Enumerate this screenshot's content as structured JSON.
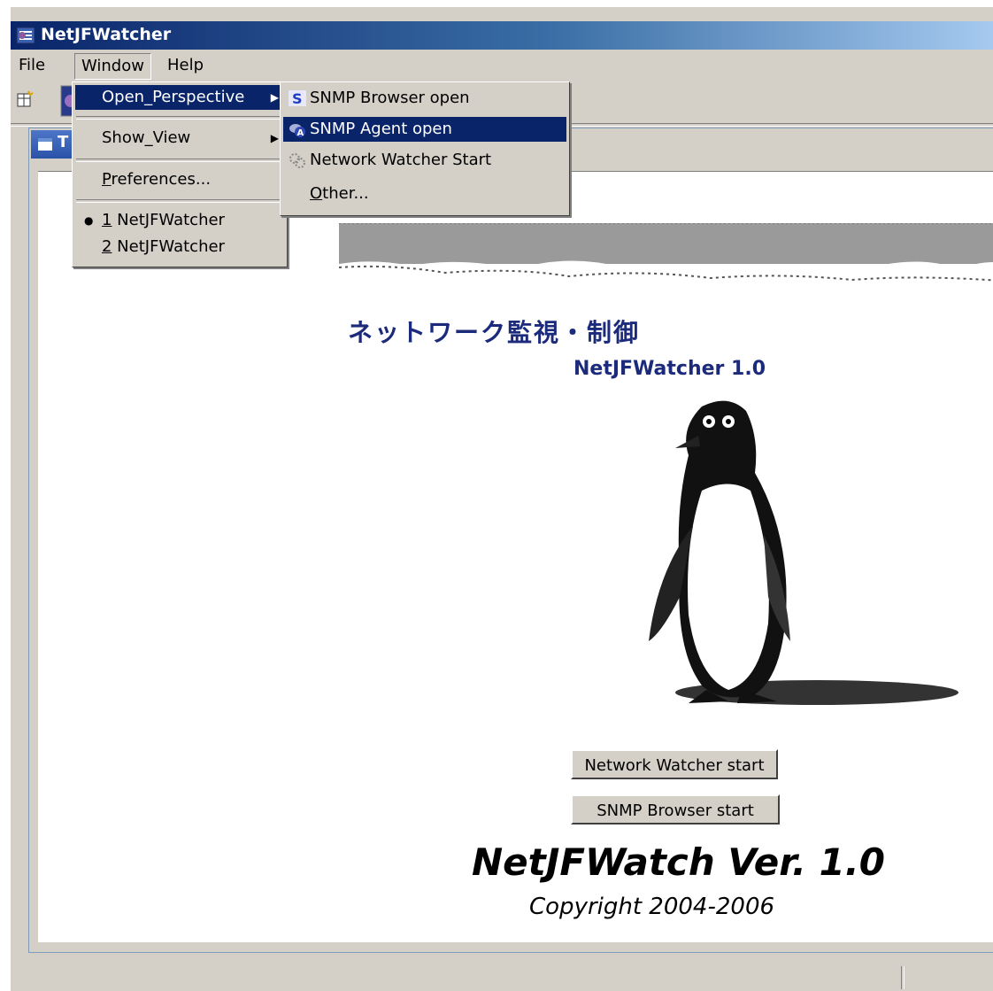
{
  "app": {
    "title": "NetJFWatcher"
  },
  "menubar": {
    "items": [
      "File",
      "Window",
      "Help"
    ]
  },
  "window_menu": {
    "open_perspective": "Open_Perspective",
    "show_view": "Show_View",
    "preferences_prefix": "",
    "preferences_u": "P",
    "preferences_rest": "references...",
    "recent": [
      {
        "num": "1",
        "label": " NetJFWatcher",
        "checked": true
      },
      {
        "num": "2",
        "label": " NetJFWatcher",
        "checked": false
      }
    ]
  },
  "perspective_submenu": {
    "items": [
      {
        "label": "SNMP Browser open",
        "icon": "snmp-browser-icon"
      },
      {
        "label": "SNMP Agent open",
        "icon": "snmp-agent-icon",
        "highlighted": true
      },
      {
        "label": "Network Watcher Start",
        "icon": "network-watcher-icon"
      }
    ],
    "other_u": "O",
    "other_rest": "ther..."
  },
  "tab": {
    "label": "T"
  },
  "splash": {
    "jp_title": "ネットワーク監視・制御",
    "version_title": "NetJFWatcher 1.0",
    "network_watcher_button": "Network Watcher start",
    "snmp_browser_button": "SNMP Browser start",
    "big_version": "NetJFWatch Ver. 1.0",
    "copyright": "Copyright 2004-2006"
  },
  "colors": {
    "title_bar": "#0a246a",
    "menu_highlight": "#0a246a",
    "text_dark_blue": "#1b2a7a"
  }
}
